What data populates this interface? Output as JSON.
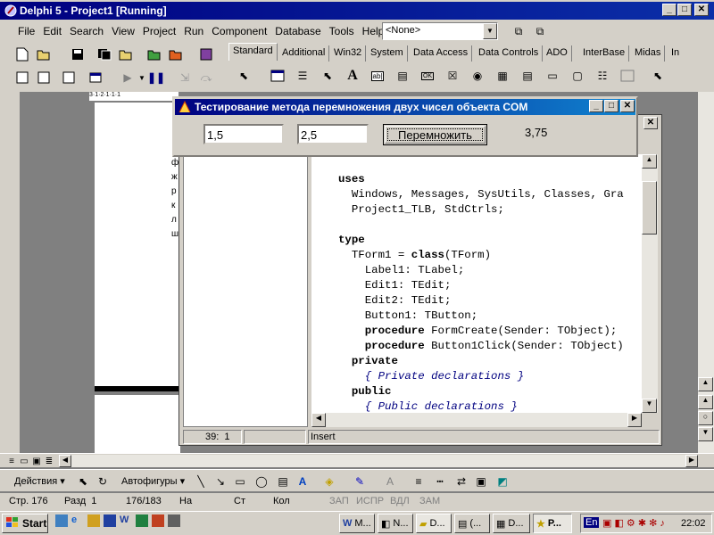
{
  "ide": {
    "title": "Delphi 5 - Project1 [Running]",
    "menu": [
      "File",
      "Edit",
      "Search",
      "View",
      "Project",
      "Run",
      "Component",
      "Database",
      "Tools",
      "Help"
    ],
    "combo_value": "<None>",
    "palette_tabs": [
      "Standard",
      "Additional",
      "Win32",
      "System",
      "Data Access",
      "Data Controls",
      "ADO",
      "InterBase",
      "Midas",
      "In"
    ]
  },
  "dialog": {
    "title": "Тестирование метода перемножения двух чисел объекта COM",
    "edit1": "1,5",
    "edit2": "2,5",
    "button": "Перемножить",
    "result": "3,75"
  },
  "editor": {
    "lines": [
      {
        "t": "uses",
        "k": true
      },
      {
        "t": "  Windows, Messages, SysUtils, Classes, Gra"
      },
      {
        "t": "  Project1_TLB, StdCtrls;"
      },
      {
        "t": ""
      },
      {
        "t": "type",
        "k": true
      },
      {
        "t": "  TForm1 = ",
        "kw2": "class",
        "rest": "(TForm)"
      },
      {
        "t": "    Label1: TLabel;"
      },
      {
        "t": "    Edit1: TEdit;"
      },
      {
        "t": "    Edit2: TEdit;"
      },
      {
        "t": "    Button1: TButton;"
      },
      {
        "t": "    ",
        "kw2": "procedure",
        "rest": " FormCreate(Sender: TObject);"
      },
      {
        "t": "    ",
        "kw2": "procedure",
        "rest": " Button1Click(Sender: TObject)"
      },
      {
        "t": "  ",
        "kw2": "private",
        "rest": ""
      },
      {
        "t": "    ",
        "cm": "{ Private declarations }"
      },
      {
        "t": "  ",
        "kw2": "public",
        "rest": ""
      },
      {
        "t": "    ",
        "cm": "{ Public declarations }"
      }
    ],
    "position": "39:  1",
    "mode": "Insert"
  },
  "word": {
    "actions": "Действия",
    "autoshapes": "Автофигуры",
    "status": {
      "page": "Стр. 176",
      "section": "Разд  1",
      "pages": "176/183",
      "at": "На",
      "line": "Ст",
      "col": "Кол",
      "rec": "ЗАП",
      "trk": "ИСПР",
      "ext": "ВДЛ",
      "ovr": "ЗАМ"
    },
    "side_letters": [
      "ф",
      "ж",
      "р",
      "к",
      "л",
      "ш"
    ]
  },
  "taskbar": {
    "start": "Start",
    "tasks": [
      "M...",
      "N...",
      "D...",
      "(...",
      "D...",
      "P..."
    ],
    "lang": "En",
    "clock": "22:02"
  },
  "colors": {
    "titlebar": "#000080",
    "face": "#d4d0c8",
    "desktop": "#808080"
  }
}
